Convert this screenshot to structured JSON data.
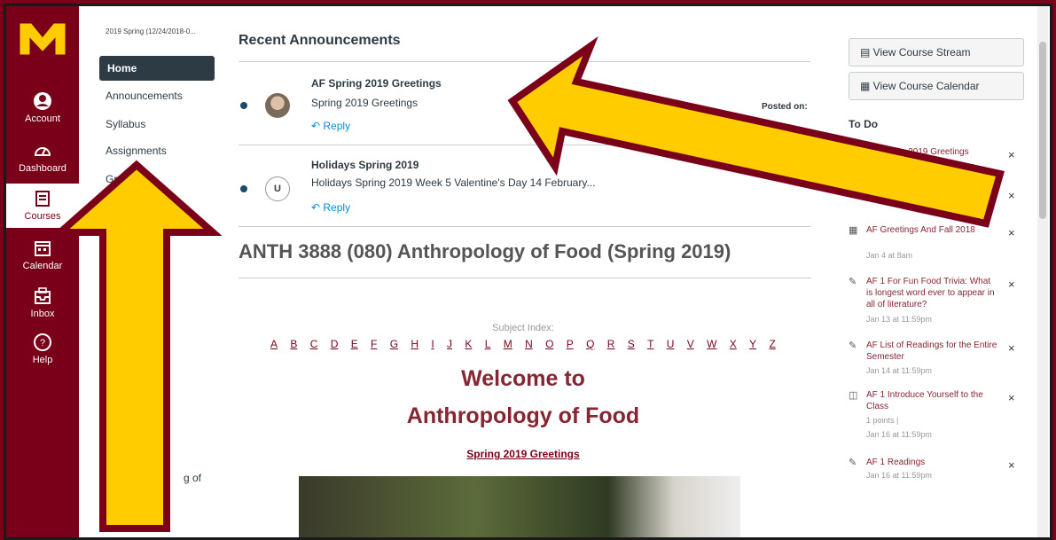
{
  "global_nav": {
    "items": [
      {
        "label": "Account",
        "icon": "account-icon"
      },
      {
        "label": "Dashboard",
        "icon": "dashboard-icon"
      },
      {
        "label": "Courses",
        "icon": "courses-icon"
      },
      {
        "label": "Calendar",
        "icon": "calendar-icon"
      },
      {
        "label": "Inbox",
        "icon": "inbox-icon"
      },
      {
        "label": "Help",
        "icon": "help-icon"
      }
    ]
  },
  "course_nav": {
    "crumb": "2019 Spring (12/24/2018-0...",
    "items": [
      "Home",
      "Announcements",
      "Syllabus",
      "Assignments",
      "Gra"
    ],
    "lower_text": "g of"
  },
  "main": {
    "recent_title": "Recent Announcements",
    "announcements": [
      {
        "title": "AF Spring 2019 Greetings",
        "text": "Spring 2019 Greetings",
        "reply": "Reply",
        "posted": "Posted on:",
        "avatar": ""
      },
      {
        "title": "Holidays Spring 2019",
        "text": "Holidays Spring 2019 Week 5 Valentine's Day 14 February...",
        "reply": "Reply",
        "posted": "",
        "avatar": "U"
      }
    ],
    "course_title": "ANTH 3888 (080) Anthropology of Food (Spring 2019)",
    "subject_index": "Subject Index:",
    "letters": [
      "A",
      "B",
      "C",
      "D",
      "E",
      "F",
      "G",
      "H",
      "I",
      "J",
      "K",
      "L",
      "M",
      "N",
      "O",
      "P",
      "Q",
      "R",
      "S",
      "T",
      "U",
      "V",
      "W",
      "X",
      "Y",
      "Z"
    ],
    "welcome1": "Welcome to",
    "welcome2": "Anthropology of Food",
    "spring_link": "Spring 2019 Greetings"
  },
  "sidebar": {
    "stream_btn": "View Course Stream",
    "calendar_btn": "View Course Calendar",
    "todo_title": "To Do",
    "todo": [
      {
        "title": "AF Spring 2019 Greetings",
        "meta": "",
        "icon": "announcement-icon"
      },
      {
        "title": "",
        "meta": "",
        "icon": "announcement-icon"
      },
      {
        "title": "AF Greetings And Fall 2018",
        "meta": "Jan 4 at 8am",
        "icon": "calendar-icon"
      },
      {
        "title": "AF 1 For Fun Food Trivia: What is longest word ever to appear in all of literature?",
        "meta": "Jan 13 at 11:59pm",
        "icon": "assignment-icon"
      },
      {
        "title": "AF List of Readings for the Entire Semester",
        "meta": "Jan 14 at 11:59pm",
        "icon": "assignment-icon"
      },
      {
        "title": "AF 1 Introduce Yourself to the Class",
        "meta": "1 points |",
        "meta2": "Jan 16 at 11:59pm",
        "icon": "discussion-icon"
      },
      {
        "title": "AF 1 Readings",
        "meta": "Jan 16 at 11:59pm",
        "icon": "assignment-icon"
      }
    ],
    "close": "×"
  },
  "colors": {
    "maroon": "#7a0019",
    "gold": "#ffcc00",
    "arrow_border": "#7a0019",
    "link": "#008ee2"
  }
}
